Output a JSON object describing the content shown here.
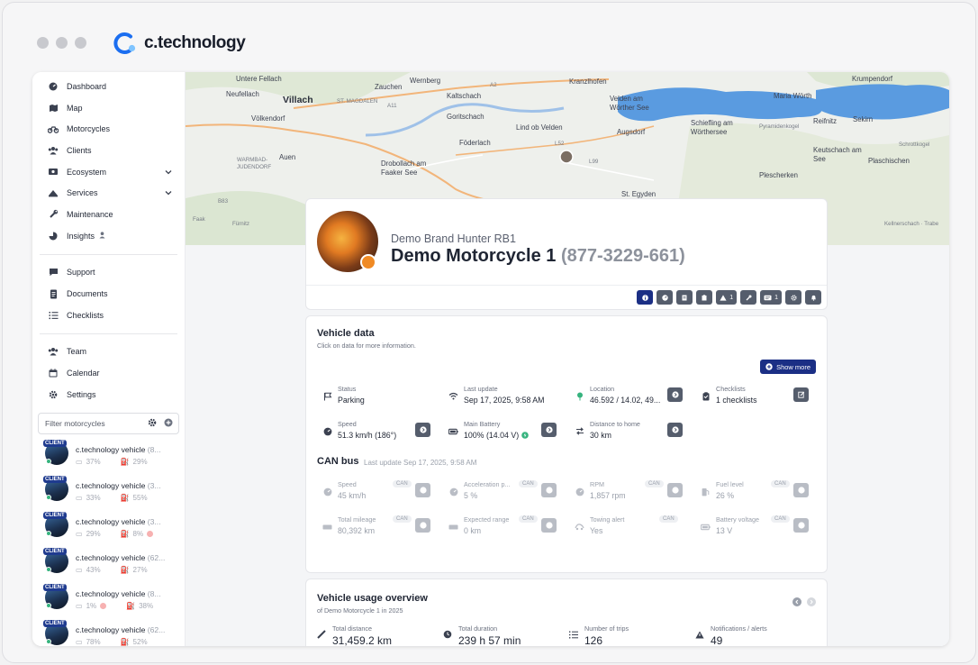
{
  "brand": {
    "name": "c.technology"
  },
  "sidebar": {
    "items": [
      {
        "label": "Dashboard",
        "icon": "dashboard-icon"
      },
      {
        "label": "Map",
        "icon": "map-icon"
      },
      {
        "label": "Motorcycles",
        "icon": "motorcycle-icon"
      },
      {
        "label": "Clients",
        "icon": "users-icon"
      },
      {
        "label": "Ecosystem",
        "icon": "ecosystem-icon",
        "expandable": true
      },
      {
        "label": "Services",
        "icon": "services-icon",
        "expandable": true
      },
      {
        "label": "Maintenance",
        "icon": "wrench-icon"
      },
      {
        "label": "Insights",
        "icon": "insights-icon"
      }
    ],
    "items2": [
      {
        "label": "Support",
        "icon": "chat-icon"
      },
      {
        "label": "Documents",
        "icon": "document-icon"
      },
      {
        "label": "Checklists",
        "icon": "checklist-icon"
      }
    ],
    "items3": [
      {
        "label": "Team",
        "icon": "team-icon"
      },
      {
        "label": "Calendar",
        "icon": "calendar-icon"
      },
      {
        "label": "Settings",
        "icon": "gear-icon"
      }
    ],
    "filter_placeholder": "Filter motorcycles",
    "vehicles": [
      {
        "badge": "CLIENT",
        "name": "c.technology vehicle",
        "suffix": "(8...",
        "battery": "37%",
        "fuel": "29%"
      },
      {
        "badge": "CLIENT",
        "name": "c.technology vehicle",
        "suffix": "(3...",
        "battery": "33%",
        "fuel": "55%"
      },
      {
        "badge": "CLIENT",
        "name": "c.technology vehicle",
        "suffix": "(3...",
        "battery": "29%",
        "fuel": "8%"
      },
      {
        "badge": "CLIENT",
        "name": "c.technology vehicle",
        "suffix": "(62...",
        "battery": "43%",
        "fuel": "27%"
      },
      {
        "badge": "CLIENT",
        "name": "c.technology vehicle",
        "suffix": "(8...",
        "battery": "1%",
        "fuel": "38%"
      },
      {
        "badge": "CLIENT",
        "name": "c.technology vehicle",
        "suffix": "(62...",
        "battery": "78%",
        "fuel": "52%"
      }
    ]
  },
  "map": {
    "labels": {
      "untere_fellach": "Untere Fellach",
      "neufellach": "Neufellach",
      "villach": "Villach",
      "volkendorf": "Völkendorf",
      "zauchen": "Zauchen",
      "st_magdalen": "ST. MAGDALEN",
      "wernberg": "Wernberg",
      "kaltschach": "Kaltschach",
      "gottschach": "Goritschach",
      "kranzlhofen": "Kranzlhofen",
      "velden": "Velden am Wörther See",
      "maria_worth": "Maria Wörth",
      "krumpendorf": "Krumpendorf",
      "lind": "Lind ob Velden",
      "foderlach": "Föderlach",
      "augsdorf": "Augsdorf",
      "schiefling": "Schiefling am Wörthersee",
      "pyramidenkogel": "Pyramidenkogel",
      "reifnitz": "Reifnitz",
      "sekirn": "Sekirn",
      "auen": "Auen",
      "warmbad": "WARMBAD-JUDENDORF",
      "drobollach": "Drobollach am Faaker See",
      "st_egyden": "St. Egyden",
      "plescherken": "Plescherken",
      "keutschach": "Keutschach am See",
      "plaschischen": "Plaschischen",
      "schrottkogel": "Schrottkogel",
      "kellnerschach": "Kellnerschach · Trabe",
      "furnitz": "Fürnitz",
      "faak": "Faak",
      "a2": "A2",
      "a11": "A11",
      "l52": "L52",
      "l99": "L99",
      "b83": "B83"
    }
  },
  "vehicle": {
    "brand": "Demo Brand Hunter RB1",
    "name": "Demo Motorcycle 1",
    "id": "(877-3229-661)"
  },
  "toolbar": {
    "alerts_count": "1",
    "messages_count": "1"
  },
  "vehicle_data": {
    "title": "Vehicle data",
    "subtitle": "Click on data for more information.",
    "show_more": "Show more",
    "fields": [
      {
        "label": "Status",
        "value": "Parking"
      },
      {
        "label": "Last update",
        "value": "Sep 17, 2025, 9:58 AM"
      },
      {
        "label": "Location",
        "value": "46.592 / 14.02, 49..."
      },
      {
        "label": "Checklists",
        "value": "1 checklists"
      },
      {
        "label": "Speed",
        "value": "51.3 km/h (186°)"
      },
      {
        "label": "Main Battery",
        "value": "100% (14.04 V)"
      },
      {
        "label": "Distance to home",
        "value": "30 km"
      }
    ]
  },
  "can_bus": {
    "title": "CAN bus",
    "last_update": "Last update Sep 17, 2025, 9:58 AM",
    "tag": "CAN",
    "fields": [
      {
        "label": "Speed",
        "value": "45 km/h"
      },
      {
        "label": "Acceleration p...",
        "value": "5 %"
      },
      {
        "label": "RPM",
        "value": "1,857 rpm"
      },
      {
        "label": "Fuel level",
        "value": "26 %"
      },
      {
        "label": "Total mileage",
        "value": "80,392 km"
      },
      {
        "label": "Expected range",
        "value": "0 km"
      },
      {
        "label": "Towing alert",
        "value": "Yes"
      },
      {
        "label": "Battery voltage",
        "value": "13 V"
      }
    ]
  },
  "usage": {
    "title": "Vehicle usage overview",
    "subtitle": "of Demo Motorcycle 1 in 2025",
    "stats": [
      {
        "label": "Total distance",
        "value": "31,459.2 km"
      },
      {
        "label": "Total duration",
        "value": "239 h 57 min"
      },
      {
        "label": "Number of trips",
        "value": "126"
      },
      {
        "label": "Notifications / alerts",
        "value": "49"
      }
    ]
  },
  "colors": {
    "accent": "#1b2f85",
    "button": "#555d6c",
    "online": "#36b37e",
    "lake": "#5a9be0"
  }
}
